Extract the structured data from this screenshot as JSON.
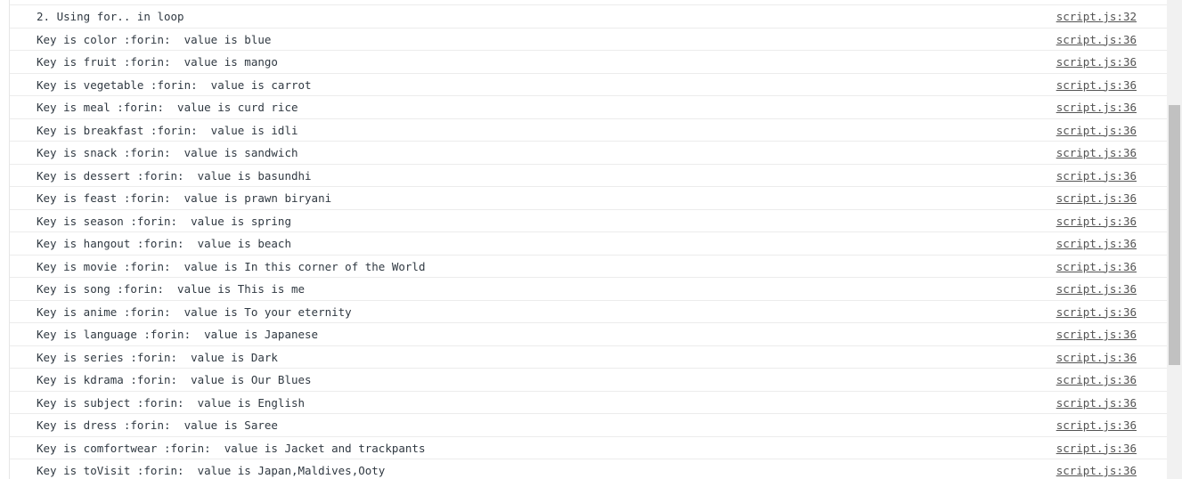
{
  "console": {
    "rows": [
      {
        "message": "2. Using for.. in loop",
        "source": "script.js:32"
      },
      {
        "message": "Key is color :forin:  value is blue",
        "source": "script.js:36"
      },
      {
        "message": "Key is fruit :forin:  value is mango",
        "source": "script.js:36"
      },
      {
        "message": "Key is vegetable :forin:  value is carrot",
        "source": "script.js:36"
      },
      {
        "message": "Key is meal :forin:  value is curd rice",
        "source": "script.js:36"
      },
      {
        "message": "Key is breakfast :forin:  value is idli",
        "source": "script.js:36"
      },
      {
        "message": "Key is snack :forin:  value is sandwich",
        "source": "script.js:36"
      },
      {
        "message": "Key is dessert :forin:  value is basundhi",
        "source": "script.js:36"
      },
      {
        "message": "Key is feast :forin:  value is prawn biryani",
        "source": "script.js:36"
      },
      {
        "message": "Key is season :forin:  value is spring",
        "source": "script.js:36"
      },
      {
        "message": "Key is hangout :forin:  value is beach",
        "source": "script.js:36"
      },
      {
        "message": "Key is movie :forin:  value is In this corner of the World",
        "source": "script.js:36"
      },
      {
        "message": "Key is song :forin:  value is This is me",
        "source": "script.js:36"
      },
      {
        "message": "Key is anime :forin:  value is To your eternity",
        "source": "script.js:36"
      },
      {
        "message": "Key is language :forin:  value is Japanese",
        "source": "script.js:36"
      },
      {
        "message": "Key is series :forin:  value is Dark",
        "source": "script.js:36"
      },
      {
        "message": "Key is kdrama :forin:  value is Our Blues",
        "source": "script.js:36"
      },
      {
        "message": "Key is subject :forin:  value is English",
        "source": "script.js:36"
      },
      {
        "message": "Key is dress :forin:  value is Saree",
        "source": "script.js:36"
      },
      {
        "message": "Key is comfortwear :forin:  value is Jacket and trackpants",
        "source": "script.js:36"
      },
      {
        "message": "Key is toVisit :forin:  value is Japan,Maldives,Ooty",
        "source": "script.js:36"
      }
    ]
  }
}
